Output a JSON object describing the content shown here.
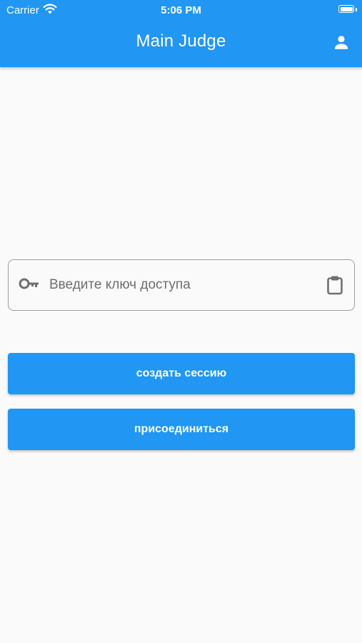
{
  "status_bar": {
    "carrier": "Carrier",
    "wifi_icon": "wifi-icon",
    "time": "5:06 PM",
    "battery_icon": "battery-icon",
    "battery_level": 1.0
  },
  "app_bar": {
    "title": "Main Judge",
    "profile_icon": "person-icon"
  },
  "access_key": {
    "leading_icon": "key-icon",
    "placeholder": "Введите ключ доступа",
    "value": "",
    "trailing_icon": "clipboard-paste-icon"
  },
  "actions": {
    "create_session_label": "создать сессию",
    "join_label": "присоединиться"
  },
  "colors": {
    "primary": "#2196f3",
    "background": "#fafafa",
    "field_border": "#9e9e9e",
    "icon_gray": "#707070"
  }
}
